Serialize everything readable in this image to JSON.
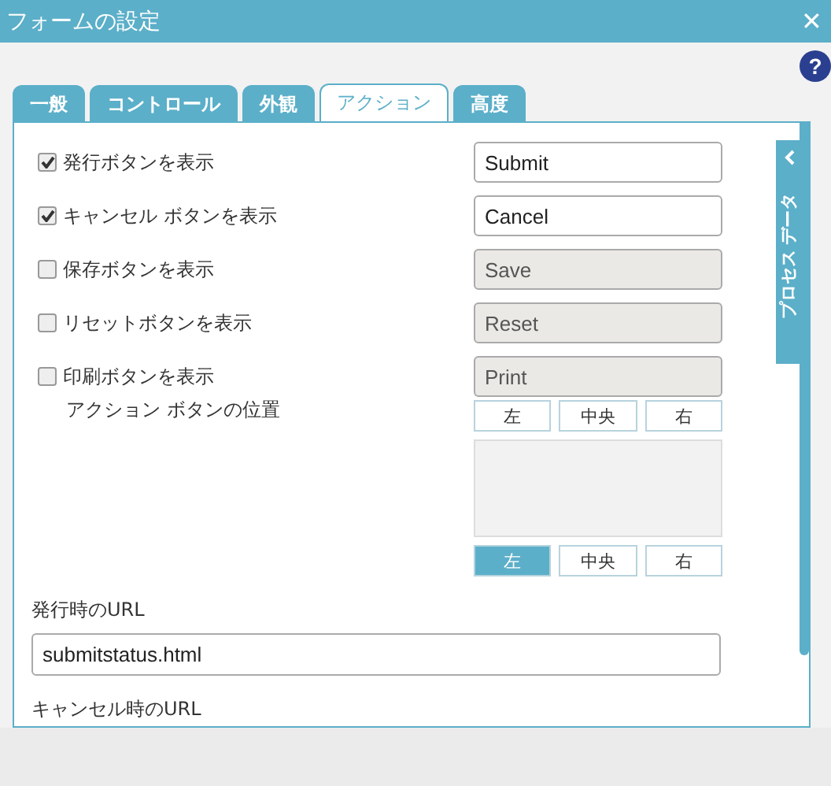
{
  "window": {
    "title": "フォームの設定",
    "close": "✕"
  },
  "help": "?",
  "tabs": [
    {
      "label": "一般",
      "selected": false
    },
    {
      "label": "コントロール",
      "selected": false
    },
    {
      "label": "外観",
      "selected": false
    },
    {
      "label": "アクション",
      "selected": true
    },
    {
      "label": "高度",
      "selected": false
    }
  ],
  "side_tab": {
    "label": "プロセス データ"
  },
  "buttons": [
    {
      "label": "発行ボタンを表示",
      "checked": true,
      "value": "Submit",
      "disabled": false
    },
    {
      "label": "キャンセル ボタンを表示",
      "checked": true,
      "value": "Cancel",
      "disabled": false
    },
    {
      "label": "保存ボタンを表示",
      "checked": false,
      "value": "Save",
      "disabled": true
    },
    {
      "label": "リセットボタンを表示",
      "checked": false,
      "value": "Reset",
      "disabled": true
    },
    {
      "label": "印刷ボタンを表示",
      "checked": false,
      "value": "Print",
      "disabled": true
    }
  ],
  "position": {
    "label": "アクション ボタンの位置",
    "top": [
      {
        "label": "左",
        "selected": false
      },
      {
        "label": "中央",
        "selected": false
      },
      {
        "label": "右",
        "selected": false
      }
    ],
    "bottom": [
      {
        "label": "左",
        "selected": true
      },
      {
        "label": "中央",
        "selected": false
      },
      {
        "label": "右",
        "selected": false
      }
    ]
  },
  "submit_url": {
    "label": "発行時のURL",
    "value": "submitstatus.html"
  },
  "cancel_url": {
    "label": "キャンセル時のURL"
  }
}
